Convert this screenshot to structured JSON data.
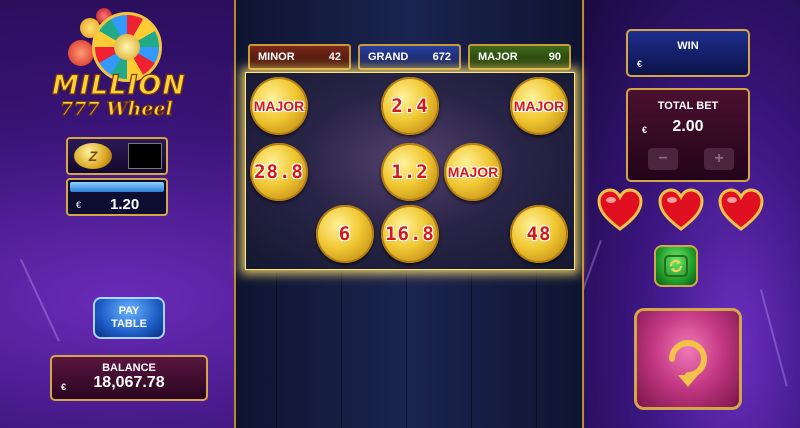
{
  "jackpots": [
    {
      "label": "MINOR",
      "value": "42"
    },
    {
      "label": "GRAND",
      "value": "672"
    },
    {
      "label": "MAJOR",
      "value": "90"
    }
  ],
  "coins": [
    "MAJOR",
    "2.4",
    "MAJOR",
    "28.8",
    "1.2",
    "MAJOR",
    "6",
    "16.8",
    "48"
  ],
  "logo": {
    "line1": "MILLION",
    "line2": "777 Wheel"
  },
  "coin_selector": {
    "symbol": "Z"
  },
  "stake": {
    "currency": "€",
    "value": "1.20"
  },
  "pay_table": {
    "line1": "PAY",
    "line2": "TABLE"
  },
  "balance": {
    "label": "BALANCE",
    "currency": "€",
    "value": "18,067.78"
  },
  "win": {
    "label": "WIN",
    "currency": "€",
    "value": ""
  },
  "total_bet": {
    "label": "TOTAL BET",
    "currency": "€",
    "value": "2.00",
    "minus": "−",
    "plus": "+"
  },
  "lives": {
    "count": 3
  },
  "colors": {
    "gold": "#d3a64a",
    "coin_text": "#d41818",
    "heart": "#e01020"
  }
}
